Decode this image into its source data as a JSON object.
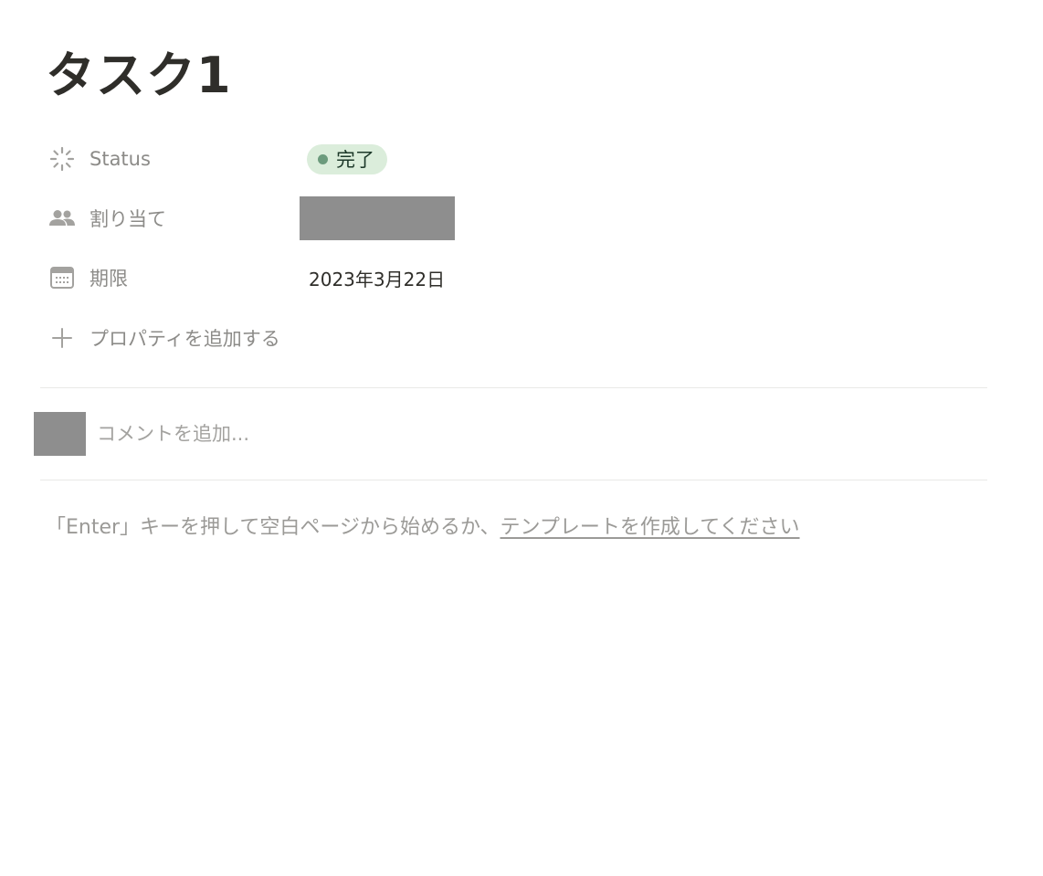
{
  "page": {
    "title": "タスク1"
  },
  "properties": [
    {
      "icon": "status-spinner-icon",
      "label": "Status",
      "type": "status",
      "value": "完了",
      "pill_color": "#dbeddb",
      "dot_color": "#6c9b7d"
    },
    {
      "icon": "people-icon",
      "label": "割り当て",
      "type": "person",
      "value": ""
    },
    {
      "icon": "calendar-icon",
      "label": "期限",
      "type": "date",
      "value": "2023年3月22日"
    }
  ],
  "add_property": {
    "icon": "plus-icon",
    "label": "プロパティを追加する"
  },
  "comment": {
    "placeholder": "コメントを追加..."
  },
  "empty_hint": {
    "prefix": "「Enter」キーを押して空白ページから始めるか、",
    "link": "テンプレートを作成してください"
  }
}
